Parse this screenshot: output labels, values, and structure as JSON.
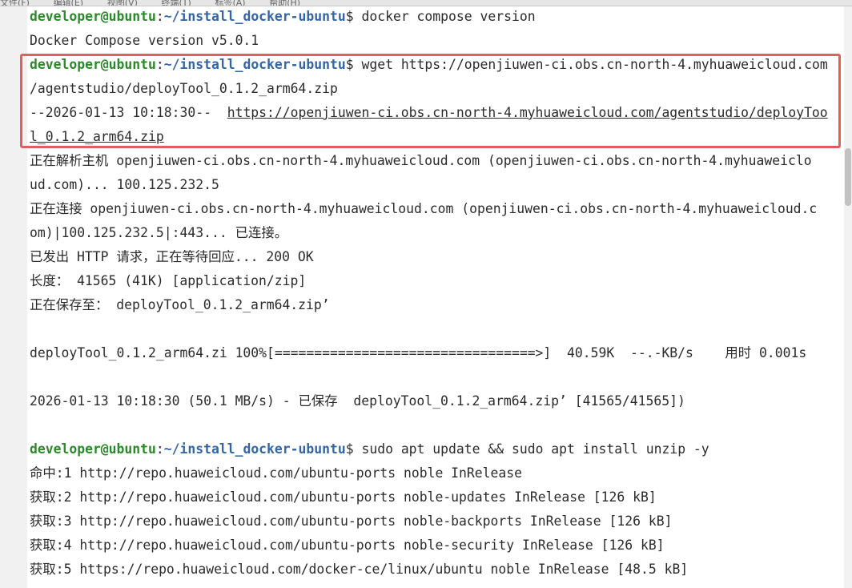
{
  "menu": [
    "文件(F)",
    "编辑(E)",
    "视图(V)",
    "终端(T)",
    "标签(A)",
    "帮助(H)"
  ],
  "prompt": {
    "user": "developer@ubuntu",
    "colon": ":",
    "path": "~/install_docker-ubuntu",
    "symbol": "$"
  },
  "lines": {
    "l1_cmd": " docker compose version",
    "l2": "Docker Compose version v5.0.1",
    "l3_cmd": " wget https://openjiuwen-ci.obs.cn-north-4.myhuaweicloud.com",
    "l4": "/agentstudio/deployTool_0.1.2_arm64.zip",
    "l5_prefix": "--2026-01-13 10:18:30--  ",
    "l5_link": "https://openjiuwen-ci.obs.cn-north-4.myhuaweicloud.com/agentstudio/deployToo",
    "l6_link": "l_0.1.2_arm64.zip",
    "l7": "正在解析主机 openjiuwen-ci.obs.cn-north-4.myhuaweicloud.com (openjiuwen-ci.obs.cn-north-4.myhuaweiclo",
    "l8": "ud.com)... 100.125.232.5",
    "l9": "正在连接 openjiuwen-ci.obs.cn-north-4.myhuaweicloud.com (openjiuwen-ci.obs.cn-north-4.myhuaweicloud.c",
    "l10": "om)|100.125.232.5|:443... 已连接。",
    "l11": "已发出 HTTP 请求，正在等待回应... 200 OK",
    "l12": "长度： 41565 (41K) [application/zip]",
    "l13": "正在保存至： deployTool_0.1.2_arm64.zip’",
    "l15": "deployTool_0.1.2_arm64.zi 100%[=================================>]  40.59K  --.-KB/s    用时 0.001s",
    "l17": "2026-01-13 10:18:30 (50.1 MB/s) - 已保存  deployTool_0.1.2_arm64.zip’ [41565/41565])",
    "l19_cmd": " sudo apt update && sudo apt install unzip -y",
    "l20": "命中:1 http://repo.huaweicloud.com/ubuntu-ports noble InRelease",
    "l21": "获取:2 http://repo.huaweicloud.com/ubuntu-ports noble-updates InRelease [126 kB]",
    "l22": "获取:3 http://repo.huaweicloud.com/ubuntu-ports noble-backports InRelease [126 kB]",
    "l23": "获取:4 http://repo.huaweicloud.com/ubuntu-ports noble-security InRelease [126 kB]",
    "l24": "获取:5 https://repo.huaweicloud.com/docker-ce/linux/ubuntu noble InRelease [48.5 kB]"
  },
  "colors": {
    "prompt_user": "#2a8a2a",
    "prompt_path": "#3465a4",
    "highlight_border": "#e45c5c",
    "terminal_bg": "#ffffff",
    "text": "#2b2b2b"
  }
}
